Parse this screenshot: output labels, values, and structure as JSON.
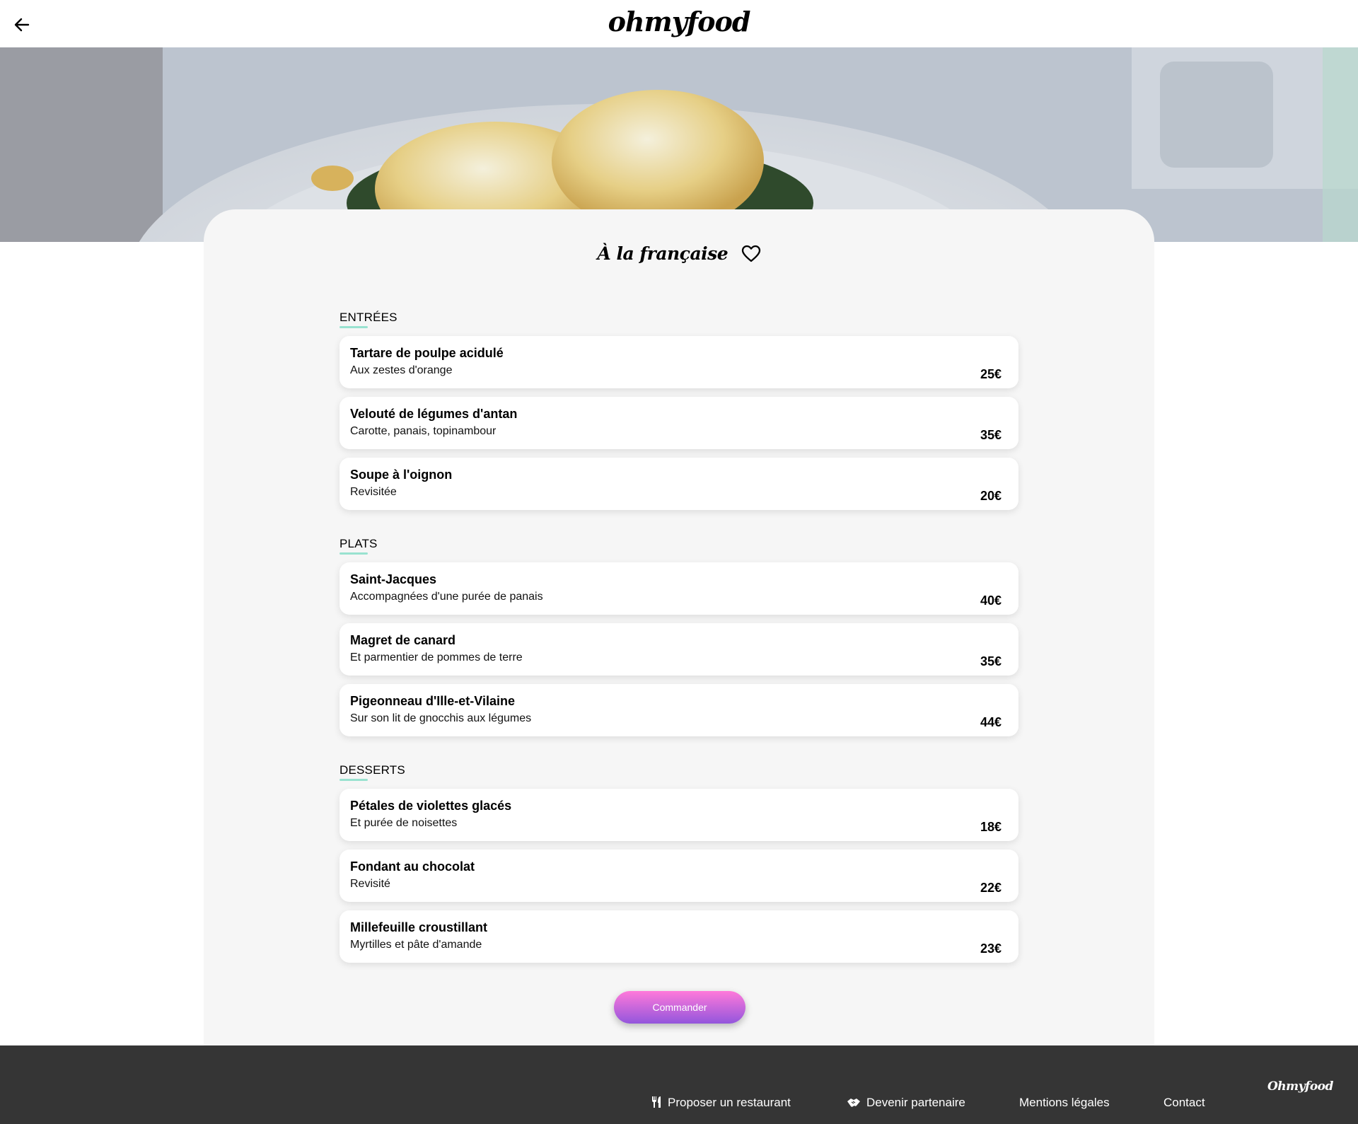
{
  "header": {
    "logo": "ohmyfood"
  },
  "restaurant": {
    "name": "À la française"
  },
  "sections": [
    {
      "title": "ENTRÉES",
      "dishes": [
        {
          "name": "Tartare de poulpe acidulé",
          "description": "Aux zestes d'orange",
          "price": "25€"
        },
        {
          "name": "Velouté de légumes d'antan",
          "description": "Carotte, panais, topinambour",
          "price": "35€"
        },
        {
          "name": "Soupe à l'oignon",
          "description": "Revisitée",
          "price": "20€"
        }
      ]
    },
    {
      "title": "PLATS",
      "dishes": [
        {
          "name": "Saint-Jacques",
          "description": "Accompagnées d'une purée de panais",
          "price": "40€"
        },
        {
          "name": "Magret de canard",
          "description": "Et parmentier de pommes de terre",
          "price": "35€"
        },
        {
          "name": "Pigeonneau d'Ille-et-Vilaine",
          "description": "Sur son lit de gnocchis aux légumes",
          "price": "44€"
        }
      ]
    },
    {
      "title": "DESSERTS",
      "dishes": [
        {
          "name": "Pétales de violettes glacés",
          "description": "Et purée de noisettes",
          "price": "18€"
        },
        {
          "name": "Fondant au chocolat",
          "description": "Revisité",
          "price": "22€"
        },
        {
          "name": "Millefeuille croustillant",
          "description": "Myrtilles et pâte d'amande",
          "price": "23€"
        }
      ]
    }
  ],
  "order_button": {
    "label": "Commander"
  },
  "footer": {
    "logo": "Ohmyfood",
    "links": [
      {
        "label": "Proposer un restaurant",
        "icon": "utensils-icon"
      },
      {
        "label": "Devenir partenaire",
        "icon": "handshake-icon"
      },
      {
        "label": "Mentions légales"
      },
      {
        "label": "Contact"
      }
    ]
  },
  "colors": {
    "accent_underline": "#99e2d0",
    "button_gradient_top": "#ff79da",
    "button_gradient_bottom": "#9356dc",
    "footer_bg": "#353535",
    "card_bg": "#f6f6f6"
  },
  "icons": {
    "back": "arrow-left-icon",
    "favorite": "heart-outline-icon"
  }
}
